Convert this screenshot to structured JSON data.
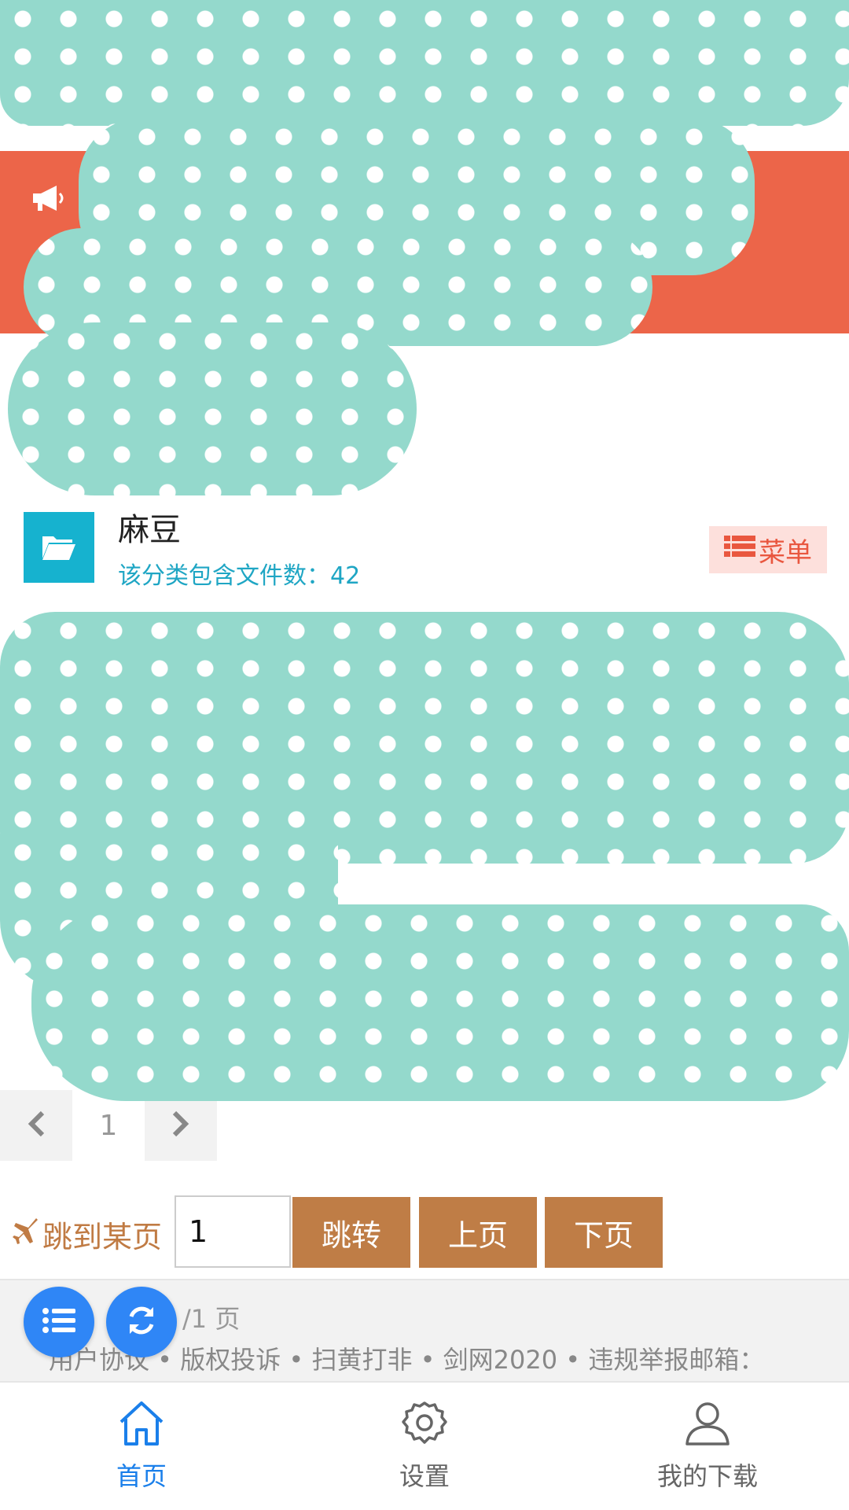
{
  "category": {
    "name": "麻豆",
    "count_label": "该分类包含文件数：42",
    "menu_label": "菜单"
  },
  "pager": {
    "current_page": "1"
  },
  "jump": {
    "label": "跳到某页",
    "input_value": "1",
    "go_label": "跳转",
    "prev_label": "上页",
    "next_label": "下页"
  },
  "footer": {
    "page_info": "/1 页",
    "links": "用户协议 • 版权投诉 • 扫黄打非 • 剑网2020 • 违规举报邮箱："
  },
  "tabbar": {
    "items": [
      {
        "label": "首页",
        "icon": "home-icon",
        "active": true
      },
      {
        "label": "设置",
        "icon": "gear-icon",
        "active": false
      },
      {
        "label": "我的下载",
        "icon": "user-icon",
        "active": false
      }
    ]
  },
  "colors": {
    "accent": "#1a7fea",
    "notice_bg": "#ec6549",
    "folder_tile": "#16b2cf",
    "button_brown": "#bf7d46",
    "menu_text": "#e9573f"
  }
}
